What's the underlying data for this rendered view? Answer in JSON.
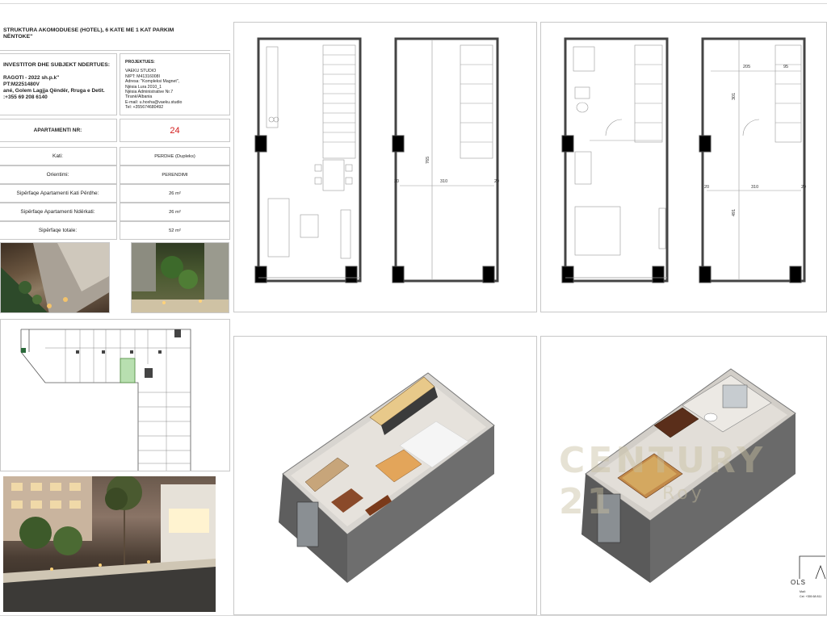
{
  "title_block": {
    "project_title_line1": "STRUKTURA AKOMODUESE (HOTEL), 6 KATE ME 1 KAT PARKIM",
    "project_title_line2": "NËNTOKE\"",
    "investor_heading": "INVESTITOR DHE SUBJEKT NDERTUES:",
    "investor_lines": [
      "RAGOTI - 2022 sh.p.k\"",
      "PT:M2251480V",
      "ané, Golem Lagjja Qëndër, Rruga e Detit.",
      ":+355 69 208 6140"
    ],
    "designer_heading": "PROJEKTUES:",
    "designer_lines": [
      "VAEKU STUDIO",
      "NIPT: M41316008I",
      "Adresa: \"Kompleksi Magnet\",",
      "Njësia Lura 2010_1",
      "Njësia Administrative Nr.7",
      "Tiranë/Albania",
      "E-mail: u.hoxha@vaeku.studio",
      "Tel: +355674680492"
    ],
    "apartment_label": "APARTAMENTI NR:",
    "apartment_number": "24",
    "rows": [
      {
        "label": "Kati:",
        "value": "PERDHE (Dupleks)"
      },
      {
        "label": "Orientimi:",
        "value": "PERENDIMI"
      },
      {
        "label": "Sipërfaqe Apartamenti Kati Përdhe:",
        "value": "26 m²"
      },
      {
        "label": "Sipërfaqe Apartamenti Ndërkati:",
        "value": "26 m²"
      },
      {
        "label": "Sipërfaqe totale:",
        "value": "52 m²"
      }
    ]
  },
  "dimensions": {
    "width_310": "310",
    "height_765": "765",
    "side_20": "20",
    "d_205": "205",
    "d_95": "95",
    "d_301": "301",
    "d_491": "491"
  },
  "watermark": {
    "brand": "CENTURY 21",
    "sub": "Roy"
  },
  "stamp": {
    "logo": "OLS",
    "line1": "Mail: ",
    "line2": "Cel: +355 68 811"
  },
  "colors": {
    "border": "#c8c8c8",
    "red": "#d21a1a",
    "selected_unit": "#b8dfb0"
  }
}
